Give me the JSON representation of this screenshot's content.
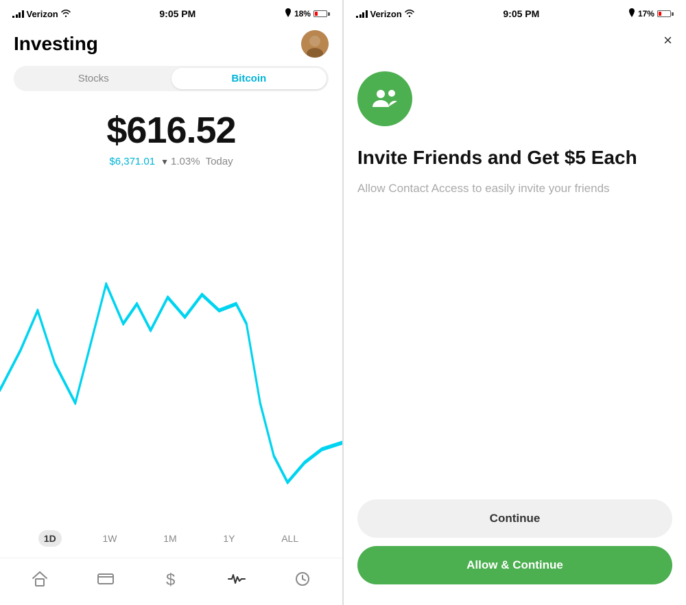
{
  "left_phone": {
    "status_bar": {
      "carrier": "Verizon",
      "time": "9:05 PM",
      "battery_percent": "18%"
    },
    "header": {
      "title": "Investing"
    },
    "tabs": [
      {
        "id": "stocks",
        "label": "Stocks",
        "active": false
      },
      {
        "id": "bitcoin",
        "label": "Bitcoin",
        "active": true
      }
    ],
    "price": {
      "main": "$616.52",
      "secondary": "$6,371.01",
      "change_pct": "1.03%",
      "period": "Today"
    },
    "time_filters": [
      {
        "id": "1d",
        "label": "1D",
        "active": true
      },
      {
        "id": "1w",
        "label": "1W",
        "active": false
      },
      {
        "id": "1m",
        "label": "1M",
        "active": false
      },
      {
        "id": "1y",
        "label": "1Y",
        "active": false
      },
      {
        "id": "all",
        "label": "ALL",
        "active": false
      }
    ],
    "nav_icons": [
      "home",
      "card",
      "dollar",
      "activity",
      "clock"
    ]
  },
  "right_phone": {
    "status_bar": {
      "carrier": "Verizon",
      "time": "9:05 PM",
      "battery_percent": "17%"
    },
    "close_label": "×",
    "icon_alt": "friends-icon",
    "title": "Invite Friends and Get $5 Each",
    "subtitle": "Allow Contact Access to easily invite your friends",
    "btn_continue": "Continue",
    "btn_allow": "Allow & Continue"
  }
}
